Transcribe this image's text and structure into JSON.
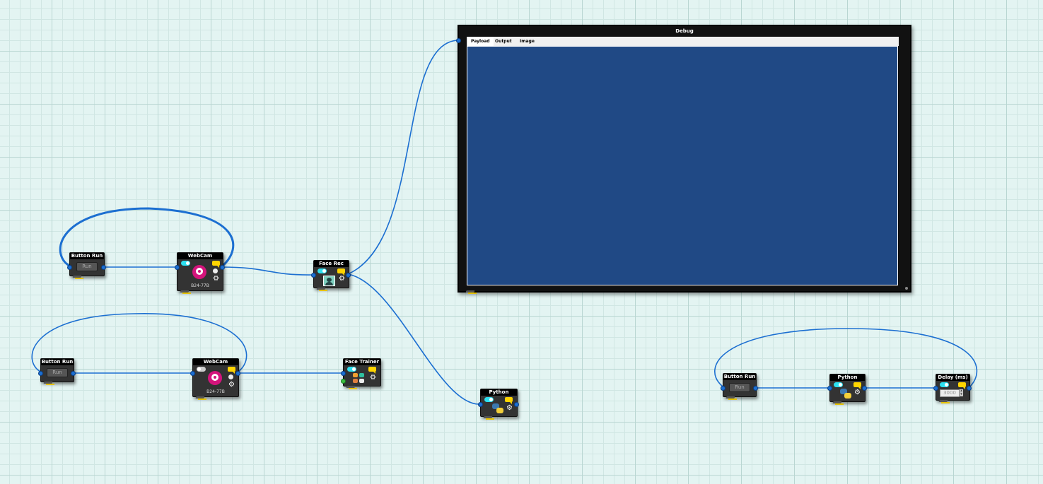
{
  "canvas": {
    "background": "#e3f4f2",
    "wire_color": "#1c6fd1"
  },
  "debug": {
    "title": "Debug",
    "tabs": [
      "Payload",
      "Output",
      "Image"
    ],
    "screen_color": "#204985"
  },
  "nodes": {
    "button_run_1": {
      "title": "Button Run",
      "button_label": "Run"
    },
    "webcam_1": {
      "title": "WebCam",
      "caption": "B24-77B",
      "toggle_on": true
    },
    "face_rec": {
      "title": "Face Rec"
    },
    "python_1": {
      "title": "Python"
    },
    "button_run_2": {
      "title": "Button Run",
      "button_label": "Run"
    },
    "webcam_2": {
      "title": "WebCam",
      "caption": "B24-77B",
      "toggle_on": false
    },
    "face_trainer": {
      "title": "Face Trainer"
    },
    "button_run_3": {
      "title": "Button Run",
      "button_label": "Run"
    },
    "python_2": {
      "title": "Python"
    },
    "delay": {
      "title": "Delay (ms)",
      "value": "3000"
    }
  },
  "icons": {
    "webcam": "webcam-icon",
    "gear": "gear-icon",
    "message": "message-icon",
    "toggle": "toggle-icon",
    "python": "python-icon",
    "face": "face-icon"
  }
}
